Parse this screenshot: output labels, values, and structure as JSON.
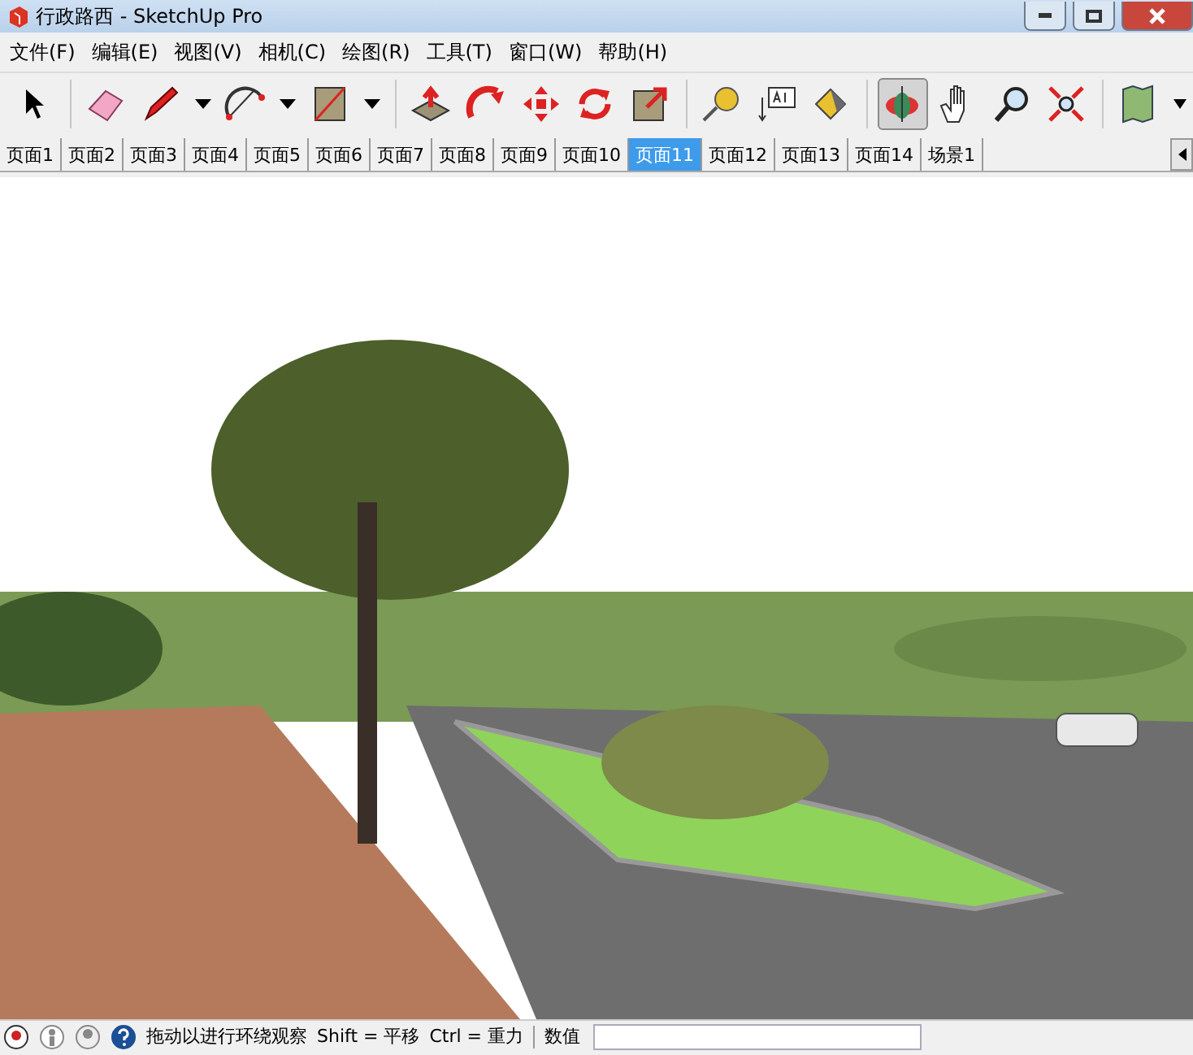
{
  "window": {
    "title": "行政路西 - SketchUp Pro"
  },
  "menu": [
    "文件(F)",
    "编辑(E)",
    "视图(V)",
    "相机(C)",
    "绘图(R)",
    "工具(T)",
    "窗口(W)",
    "帮助(H)"
  ],
  "toolbar": [
    {
      "kind": "select",
      "selected": false
    },
    {
      "kind": "sep"
    },
    {
      "kind": "eraser",
      "selected": false
    },
    {
      "kind": "pencil",
      "selected": false
    },
    {
      "kind": "dropdown"
    },
    {
      "kind": "arc",
      "selected": false
    },
    {
      "kind": "dropdown"
    },
    {
      "kind": "rect",
      "selected": false
    },
    {
      "kind": "dropdown"
    },
    {
      "kind": "sep"
    },
    {
      "kind": "pushpull",
      "selected": false
    },
    {
      "kind": "followme",
      "selected": false
    },
    {
      "kind": "move",
      "selected": false
    },
    {
      "kind": "rotate",
      "selected": false
    },
    {
      "kind": "scale",
      "selected": false
    },
    {
      "kind": "sep"
    },
    {
      "kind": "tape",
      "selected": false
    },
    {
      "kind": "text",
      "selected": false
    },
    {
      "kind": "paint",
      "selected": false
    },
    {
      "kind": "sep"
    },
    {
      "kind": "orbit",
      "selected": true
    },
    {
      "kind": "pan",
      "selected": false
    },
    {
      "kind": "zoom",
      "selected": false
    },
    {
      "kind": "extents",
      "selected": false
    },
    {
      "kind": "sep"
    },
    {
      "kind": "map",
      "selected": false
    }
  ],
  "tabs": [
    {
      "label": "页面1",
      "selected": false
    },
    {
      "label": "页面2",
      "selected": false
    },
    {
      "label": "页面3",
      "selected": false
    },
    {
      "label": "页面4",
      "selected": false
    },
    {
      "label": "页面5",
      "selected": false
    },
    {
      "label": "页面6",
      "selected": false
    },
    {
      "label": "页面7",
      "selected": false
    },
    {
      "label": "页面8",
      "selected": false
    },
    {
      "label": "页面9",
      "selected": false
    },
    {
      "label": "页面10",
      "selected": false
    },
    {
      "label": "页面11",
      "selected": true
    },
    {
      "label": "页面12",
      "selected": false
    },
    {
      "label": "页面13",
      "selected": false
    },
    {
      "label": "页面14",
      "selected": false
    },
    {
      "label": "场景1",
      "selected": false
    }
  ],
  "status_bar": {
    "hint": "拖动以进行环绕观察",
    "shift": "Shift = 平移",
    "ctrl": "Ctrl = 重力",
    "value_label": "数值"
  }
}
